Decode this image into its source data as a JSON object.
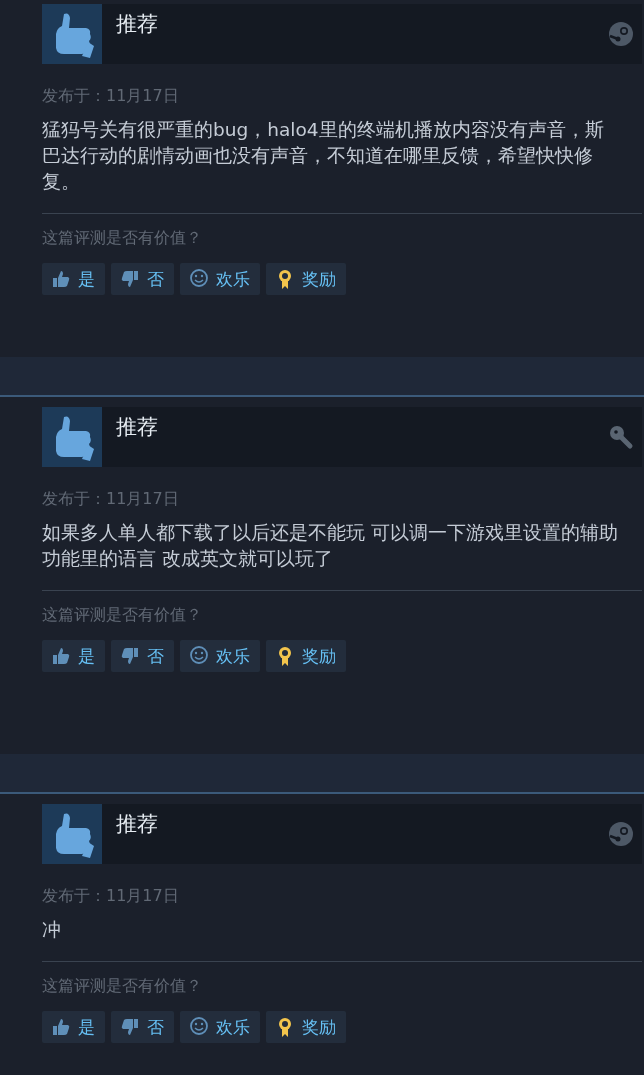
{
  "reviews": [
    {
      "verdict": "推荐",
      "source": {
        "kind": "steam"
      },
      "posted": "发布于：11月17日",
      "text": "猛犸号关有很严重的bug，halo4里的终端机播放内容没有声音，斯巴达行动的剧情动画也没有声音，不知道在哪里反馈，希望快快修复。",
      "question": "这篇评测是否有价值？",
      "buttons": [
        {
          "kind": "yes",
          "label": "是"
        },
        {
          "kind": "no",
          "label": "否"
        },
        {
          "kind": "funny",
          "label": "欢乐"
        },
        {
          "kind": "award",
          "label": "奖励"
        }
      ]
    },
    {
      "verdict": "推荐",
      "source": {
        "kind": "key"
      },
      "posted": "发布于：11月17日",
      "text": "如果多人单人都下载了以后还是不能玩 可以调一下游戏里设置的辅助功能里的语言 改成英文就可以玩了",
      "question": "这篇评测是否有价值？",
      "buttons": [
        {
          "kind": "yes",
          "label": "是"
        },
        {
          "kind": "no",
          "label": "否"
        },
        {
          "kind": "funny",
          "label": "欢乐"
        },
        {
          "kind": "award",
          "label": "奖励"
        }
      ]
    },
    {
      "verdict": "推荐",
      "source": {
        "kind": "steam"
      },
      "posted": "发布于：11月17日",
      "text": "冲",
      "question": "这篇评测是否有价值？",
      "buttons": [
        {
          "kind": "yes",
          "label": "是"
        },
        {
          "kind": "no",
          "label": "否"
        },
        {
          "kind": "funny",
          "label": "欢乐"
        },
        {
          "kind": "award",
          "label": "奖励"
        }
      ]
    }
  ]
}
